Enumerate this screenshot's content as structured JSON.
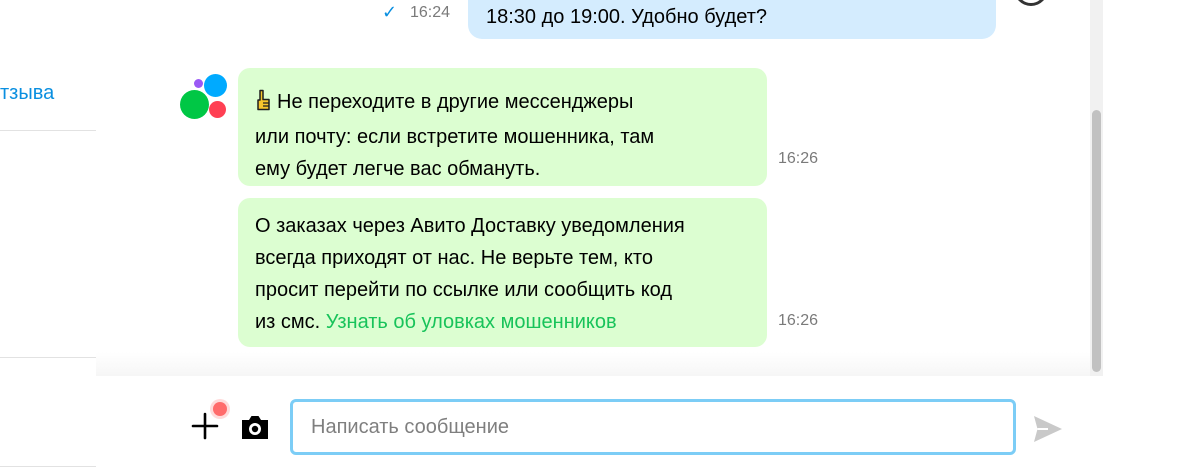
{
  "sidebar": {
    "link_label": "тзыва"
  },
  "chat": {
    "outgoing": [
      {
        "text": "18:30 до 19:00. Удобно будет?",
        "time": "16:24",
        "status_icon": "check-icon"
      }
    ],
    "incoming": [
      {
        "sender_icon": "avito-logo",
        "emoji_icon": "pointing-finger-icon",
        "lines": [
          "Не переходите в другие мессенджеры",
          "или почту: если встретите мошенника, там",
          "ему будет легче вас обмануть."
        ],
        "time": "16:26"
      },
      {
        "lines": [
          "О заказах через Авито Доставку уведомления",
          "всегда приходят от нас. Не верьте тем, кто",
          "просит перейти по ссылке или сообщить код"
        ],
        "last_line_prefix": "из смс.",
        "link_text": "Узнать об уловках мошенников",
        "time": "16:26"
      }
    ]
  },
  "composer": {
    "placeholder": "Написать сообщение",
    "value": "",
    "icons": [
      "plus-icon",
      "camera-icon",
      "send-icon"
    ]
  },
  "colors": {
    "accent_blue": "#0a8fe0",
    "incoming_bubble": "#dcfed1",
    "outgoing_bubble": "#d4ecfe",
    "link_green": "#18c35a",
    "input_border": "#7ccdf6",
    "notification_dot": "#ff6b6b"
  }
}
